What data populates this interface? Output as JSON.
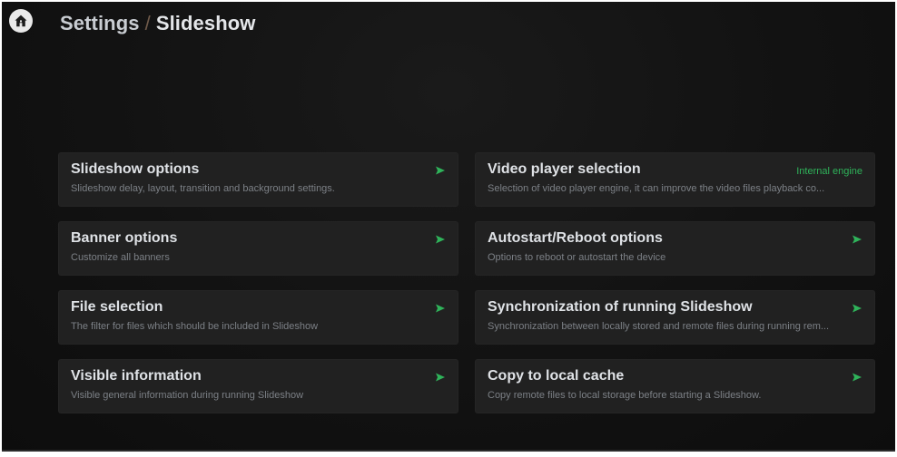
{
  "header": {
    "root": "Settings",
    "separator": "/",
    "current": "Slideshow"
  },
  "icons": {
    "home": "home-icon",
    "arrow": "arrow-right-icon"
  },
  "colors": {
    "accent": "#2fb35a",
    "card_bg": "#212121",
    "background": "#121212"
  },
  "cards": [
    {
      "title": "Slideshow options",
      "description": "Slideshow delay, layout, transition and background settings."
    },
    {
      "title": "Video player selection",
      "description": "Selection of video player engine, it can improve the video files playback co...",
      "value": "Internal engine"
    },
    {
      "title": "Banner options",
      "description": "Customize all banners"
    },
    {
      "title": "Autostart/Reboot options",
      "description": "Options to reboot or autostart the device"
    },
    {
      "title": "File selection",
      "description": "The filter for files which should be included in Slideshow"
    },
    {
      "title": "Synchronization of running Slideshow",
      "description": "Synchronization between locally stored and remote files during running rem..."
    },
    {
      "title": "Visible information",
      "description": "Visible general information during running Slideshow"
    },
    {
      "title": "Copy to local cache",
      "description": "Copy remote files to local storage before starting a Slideshow."
    }
  ]
}
